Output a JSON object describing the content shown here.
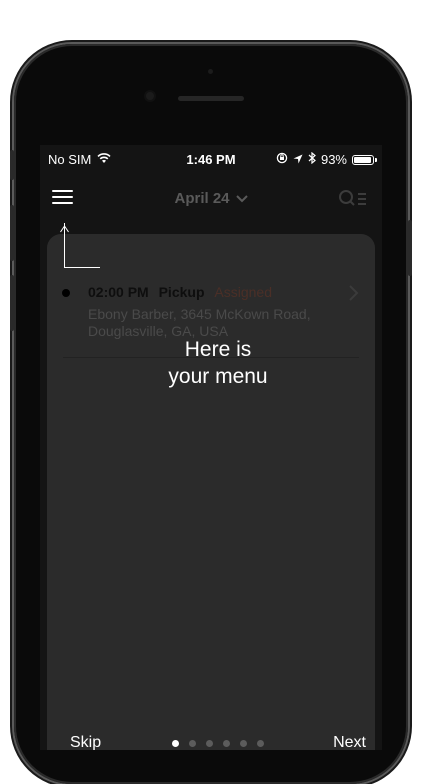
{
  "status_bar": {
    "carrier": "No SIM",
    "time": "1:46 PM",
    "battery_percent": "93%",
    "battery_level": 0.93,
    "icons": [
      "wifi-icon",
      "rotation-lock-icon",
      "location-arrow-icon",
      "bluetooth-icon",
      "battery-icon"
    ]
  },
  "navbar": {
    "date_label": "April 24",
    "icons": [
      "menu-icon",
      "chevron-down-icon",
      "search-list-icon"
    ]
  },
  "background_list": {
    "items": [
      {
        "time": "02:00 PM",
        "type": "Pickup",
        "status": "Assigned",
        "address": "Ebony Barber, 3645 McKown Road, Douglasville, GA, USA"
      }
    ]
  },
  "coach_mark": {
    "message_line1": "Here is",
    "message_line2": "your menu"
  },
  "onboarding": {
    "skip_label": "Skip",
    "next_label": "Next",
    "total_steps": 6,
    "current_step": 1
  },
  "colors": {
    "screen_bg": "#141414",
    "card_bg": "#2b2b2b",
    "text_primary": "#ffffff",
    "dot_inactive": "#5c5c5c",
    "status_assigned": "#4b2f27"
  }
}
